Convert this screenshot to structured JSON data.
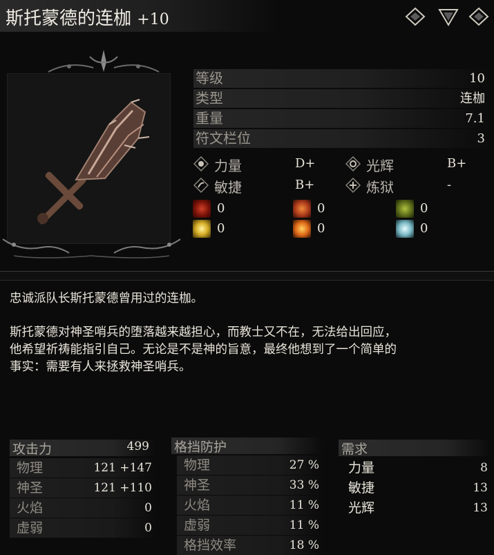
{
  "title": {
    "name": "斯托蒙德的连枷",
    "level": "+10"
  },
  "nav_icons": [
    "diamond-icon",
    "triangle-down-icon",
    "diamond-icon"
  ],
  "stats": [
    {
      "label": "等级",
      "value": "10"
    },
    {
      "label": "类型",
      "value": "连枷"
    },
    {
      "label": "重量",
      "value": "7.1"
    },
    {
      "label": "符文栏位",
      "value": "3"
    }
  ],
  "scaling": [
    {
      "icon": "strength-icon",
      "label": "力量",
      "grade": "D+"
    },
    {
      "icon": "radiance-icon",
      "label": "光辉",
      "grade": "B+"
    },
    {
      "icon": "dexterity-icon",
      "label": "敏捷",
      "grade": "B+"
    },
    {
      "icon": "purgatory-icon",
      "label": "炼狱",
      "grade": "-"
    }
  ],
  "effects": [
    {
      "icon": "bleed-icon",
      "color": "#9a1c12",
      "value": "0"
    },
    {
      "icon": "fire-buildup-icon",
      "color": "#c9521a",
      "value": "0"
    },
    {
      "icon": "poison-icon",
      "color": "#7a8a22",
      "value": "0"
    },
    {
      "icon": "holy-icon",
      "color": "#e0c43a",
      "value": "0"
    },
    {
      "icon": "explosion-icon",
      "color": "#e2781c",
      "value": "0"
    },
    {
      "icon": "frost-icon",
      "color": "#8fc6cf",
      "value": "0"
    }
  ],
  "description": {
    "line1": "忠诚派队长斯托蒙德曾用过的连枷。",
    "line2": "斯托蒙德对神圣哨兵的堕落越来越担心，而教士又不在，无法给出回应，",
    "line3": "他希望祈祷能指引自己。无论是不是神的旨意，最终他想到了一个简单的",
    "line4": "事实：需要有人来拯救神圣哨兵。"
  },
  "attack": {
    "header": "攻击力",
    "total": "499",
    "rows": [
      {
        "label": "物理",
        "value": "121 +147"
      },
      {
        "label": "神圣",
        "value": "121 +110"
      },
      {
        "label": "火焰",
        "value": "0"
      },
      {
        "label": "虚弱",
        "value": "0"
      }
    ]
  },
  "guard": {
    "header": "格挡防护",
    "rows": [
      {
        "label": "物理",
        "value": "27 %"
      },
      {
        "label": "神圣",
        "value": "33 %"
      },
      {
        "label": "火焰",
        "value": "11 %"
      },
      {
        "label": "虚弱",
        "value": "11 %"
      },
      {
        "label": "格挡效率",
        "value": "18 %"
      }
    ]
  },
  "requirements": {
    "header": "需求",
    "rows": [
      {
        "label": "力量",
        "value": "8"
      },
      {
        "label": "敏捷",
        "value": "13"
      },
      {
        "label": "光辉",
        "value": "13"
      }
    ]
  }
}
